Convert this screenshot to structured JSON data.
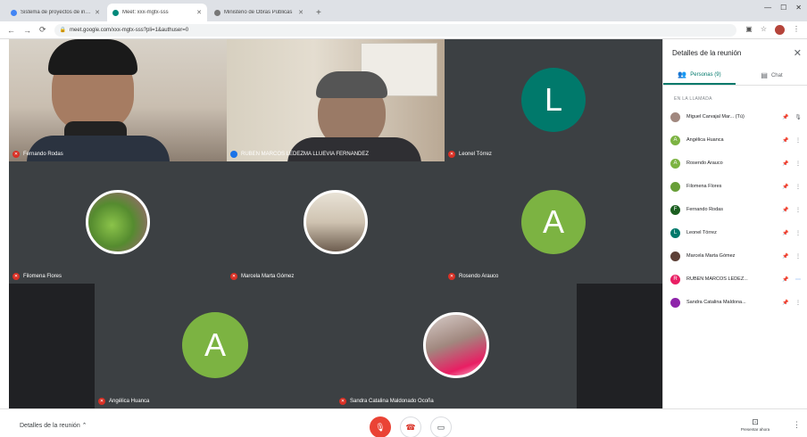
{
  "browser": {
    "tabs": [
      {
        "label": "Sistema de proyectos de investigación",
        "active": false
      },
      {
        "label": "Meet: xxx-mgtx-sss",
        "active": true
      },
      {
        "label": "Ministerio de Obras Públicas",
        "active": false
      }
    ],
    "url": "meet.google.com/xxx-mgtx-sss?pli=1&authuser=0",
    "new_tab": "+"
  },
  "tiles": [
    {
      "name": "Fernando Rodas",
      "kind": "camera",
      "status": "mute"
    },
    {
      "name": "RUBEN MARCOS LEDEZMA LLUEVIA FERNANDEZ",
      "kind": "camera",
      "status": "speaking"
    },
    {
      "name": "Leonel Tórrez",
      "kind": "avatar",
      "letter": "L",
      "color": "#00796b",
      "status": "mute"
    },
    {
      "name": "Filomena Flores",
      "kind": "photo",
      "status": "mute"
    },
    {
      "name": "Marcela Marta Gómez",
      "kind": "photo",
      "status": "mute"
    },
    {
      "name": "Rosendo Arauco",
      "kind": "avatar",
      "letter": "A",
      "color": "#7cb342",
      "status": "mute"
    },
    {
      "name": "Angélica Huanca",
      "kind": "avatar",
      "letter": "A",
      "color": "#7cb342",
      "status": "mute"
    },
    {
      "name": "Sandra Catalina Maldonado Ocoña",
      "kind": "photo",
      "status": "mute"
    }
  ],
  "panel": {
    "title": "Detalles de la reunión",
    "tab_people": "Personas (9)",
    "tab_chat": "Chat",
    "list_header": "EN LA LLAMADA",
    "participants": [
      {
        "name": "Miguel Carvajal Mar... (Tú)",
        "avatar": "photo",
        "color": "#a1887f"
      },
      {
        "name": "Angélica Huanca",
        "avatar": "A",
        "color": "#7cb342"
      },
      {
        "name": "Rosendo Arauco",
        "avatar": "A",
        "color": "#7cb342"
      },
      {
        "name": "Filomena Flores",
        "avatar": "photo",
        "color": "#689f38"
      },
      {
        "name": "Fernando Rodas",
        "avatar": "F",
        "color": "#1b5e20"
      },
      {
        "name": "Leonel Tórrez",
        "avatar": "L",
        "color": "#00796b"
      },
      {
        "name": "Marcela Marta Gómez",
        "avatar": "photo",
        "color": "#5d4037"
      },
      {
        "name": "RUBEN MARCOS LEDEZ...",
        "avatar": "R",
        "color": "#e91e63"
      },
      {
        "name": "Sandra Catalina Maldona...",
        "avatar": "photo",
        "color": "#8e24aa"
      }
    ]
  },
  "bottom": {
    "details_label": "Detalles de la reunión",
    "present_label": "Presentar ahora"
  }
}
